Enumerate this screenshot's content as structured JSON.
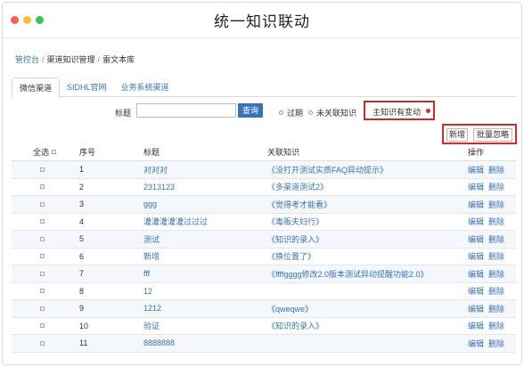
{
  "window": {
    "title": "统一知识联动"
  },
  "breadcrumb": {
    "items": [
      "管控台",
      "渠道知识管理",
      "雷文本库"
    ]
  },
  "tabs": [
    {
      "label": "微信渠道",
      "active": true
    },
    {
      "label": "SIDHL官网",
      "active": false
    },
    {
      "label": "业务系统渠道",
      "active": false
    }
  ],
  "filter": {
    "label": "标题",
    "input_value": "",
    "search_label": "查询",
    "opt_expired": "过期",
    "opt_unlinked": "未关联知识",
    "opt_changed": "主知识有变动"
  },
  "actions": {
    "add_label": "新增",
    "batch_ignore_label": "批量忽略"
  },
  "table": {
    "headers": {
      "select_all": "全选",
      "seq": "序号",
      "title": "标题",
      "knowledge": "关联知识",
      "ops": "操作"
    },
    "op_edit": "编辑",
    "op_delete": "删除",
    "rows": [
      {
        "seq": "1",
        "title": "对对对",
        "knowledge": "《没打开测试实质FAQ异动提示》"
      },
      {
        "seq": "2",
        "title": "2313123",
        "knowledge": "《多渠道测试2》"
      },
      {
        "seq": "3",
        "title": "ggg",
        "knowledge": "《觉得考才能看》"
      },
      {
        "seq": "4",
        "title": "灌灌灌灌灌过过过",
        "knowledge": "《毒贩夫妇行》"
      },
      {
        "seq": "5",
        "title": "测试",
        "knowledge": "《知识的录入》"
      },
      {
        "seq": "6",
        "title": "新增",
        "knowledge": "《换位置了》"
      },
      {
        "seq": "7",
        "title": "fff",
        "knowledge": "《ffffgggg修改2.0版本测试异动提醒功能2.0》"
      },
      {
        "seq": "8",
        "title": "12",
        "knowledge": ""
      },
      {
        "seq": "9",
        "title": "1212",
        "knowledge": "《qweqwe》"
      },
      {
        "seq": "10",
        "title": "验证",
        "knowledge": "《知识的录入》"
      },
      {
        "seq": "11",
        "title": "8888888",
        "knowledge": ""
      }
    ]
  },
  "colors": {
    "link": "#3a72b5",
    "highlight": "#d9262c",
    "search_button": "#3a72b5"
  }
}
